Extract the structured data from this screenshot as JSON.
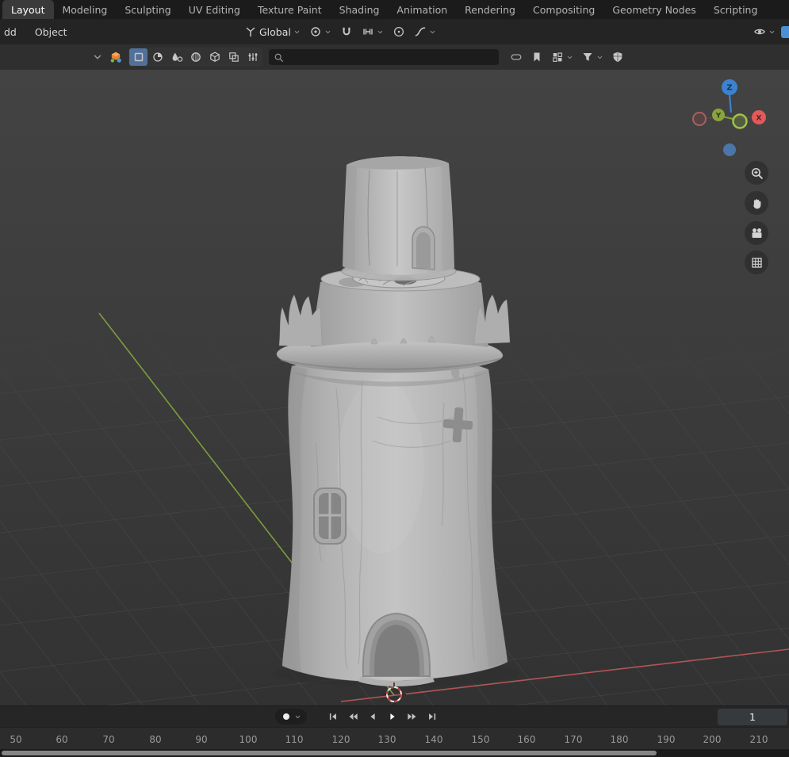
{
  "colors": {
    "viewport_bg": "#3a3a3a",
    "clay_model": "#b9b9b9",
    "axis_x": "#c05959",
    "axis_y": "#83a83d",
    "axis_z": "#3d82cf",
    "active_mode_highlight": "#51719a",
    "editor_icon_orange": "#e8842c",
    "editor_icon_blue": "#4a90d9",
    "editor_icon_green": "#6fbf4a"
  },
  "icons": {
    "search-icon": "magnifier",
    "transform-orientation-icon": "three-axes",
    "pivot-point-icon": "concentric-circles",
    "snap-magnet-icon": "magnet",
    "snap-target-icon": "snap-bars",
    "proportional-editing-icon": "circled-dot",
    "falloff-curve-icon": "ease-curve",
    "visibility-eye-icon": "eye",
    "filter-funnel-icon": "funnel",
    "overlay-shield-icon": "shield",
    "bookmark-icon": "bookmark",
    "display-mode-icon": "quad-squares",
    "zoom-icon": "magnifier-plus",
    "pan-icon": "hand",
    "camera-view-icon": "movie-camera",
    "ortho-grid-icon": "grid-square",
    "record-icon": "dot",
    "chevron-down-icon": "chevron-down",
    "editor-type-icon": "colorful-3d-viewport"
  },
  "topbar": {
    "tabs": [
      {
        "label": "Layout",
        "active": true
      },
      {
        "label": "Modeling",
        "active": false
      },
      {
        "label": "Sculpting",
        "active": false
      },
      {
        "label": "UV Editing",
        "active": false
      },
      {
        "label": "Texture Paint",
        "active": false
      },
      {
        "label": "Shading",
        "active": false
      },
      {
        "label": "Animation",
        "active": false
      },
      {
        "label": "Rendering",
        "active": false
      },
      {
        "label": "Compositing",
        "active": false
      },
      {
        "label": "Geometry Nodes",
        "active": false
      },
      {
        "label": "Scripting",
        "active": false
      }
    ]
  },
  "menubar": {
    "add_menu": "dd",
    "object_menu": "Object",
    "orientation": "Global"
  },
  "header": {
    "search_value": ""
  },
  "gizmo": {
    "x": "X",
    "y": "Y",
    "z": "Z"
  },
  "timeline": {
    "frame": "1"
  },
  "ruler": {
    "ticks": [
      "50",
      "60",
      "70",
      "80",
      "90",
      "100",
      "110",
      "120",
      "130",
      "140",
      "150",
      "160",
      "170",
      "180",
      "190",
      "200",
      "210"
    ]
  }
}
